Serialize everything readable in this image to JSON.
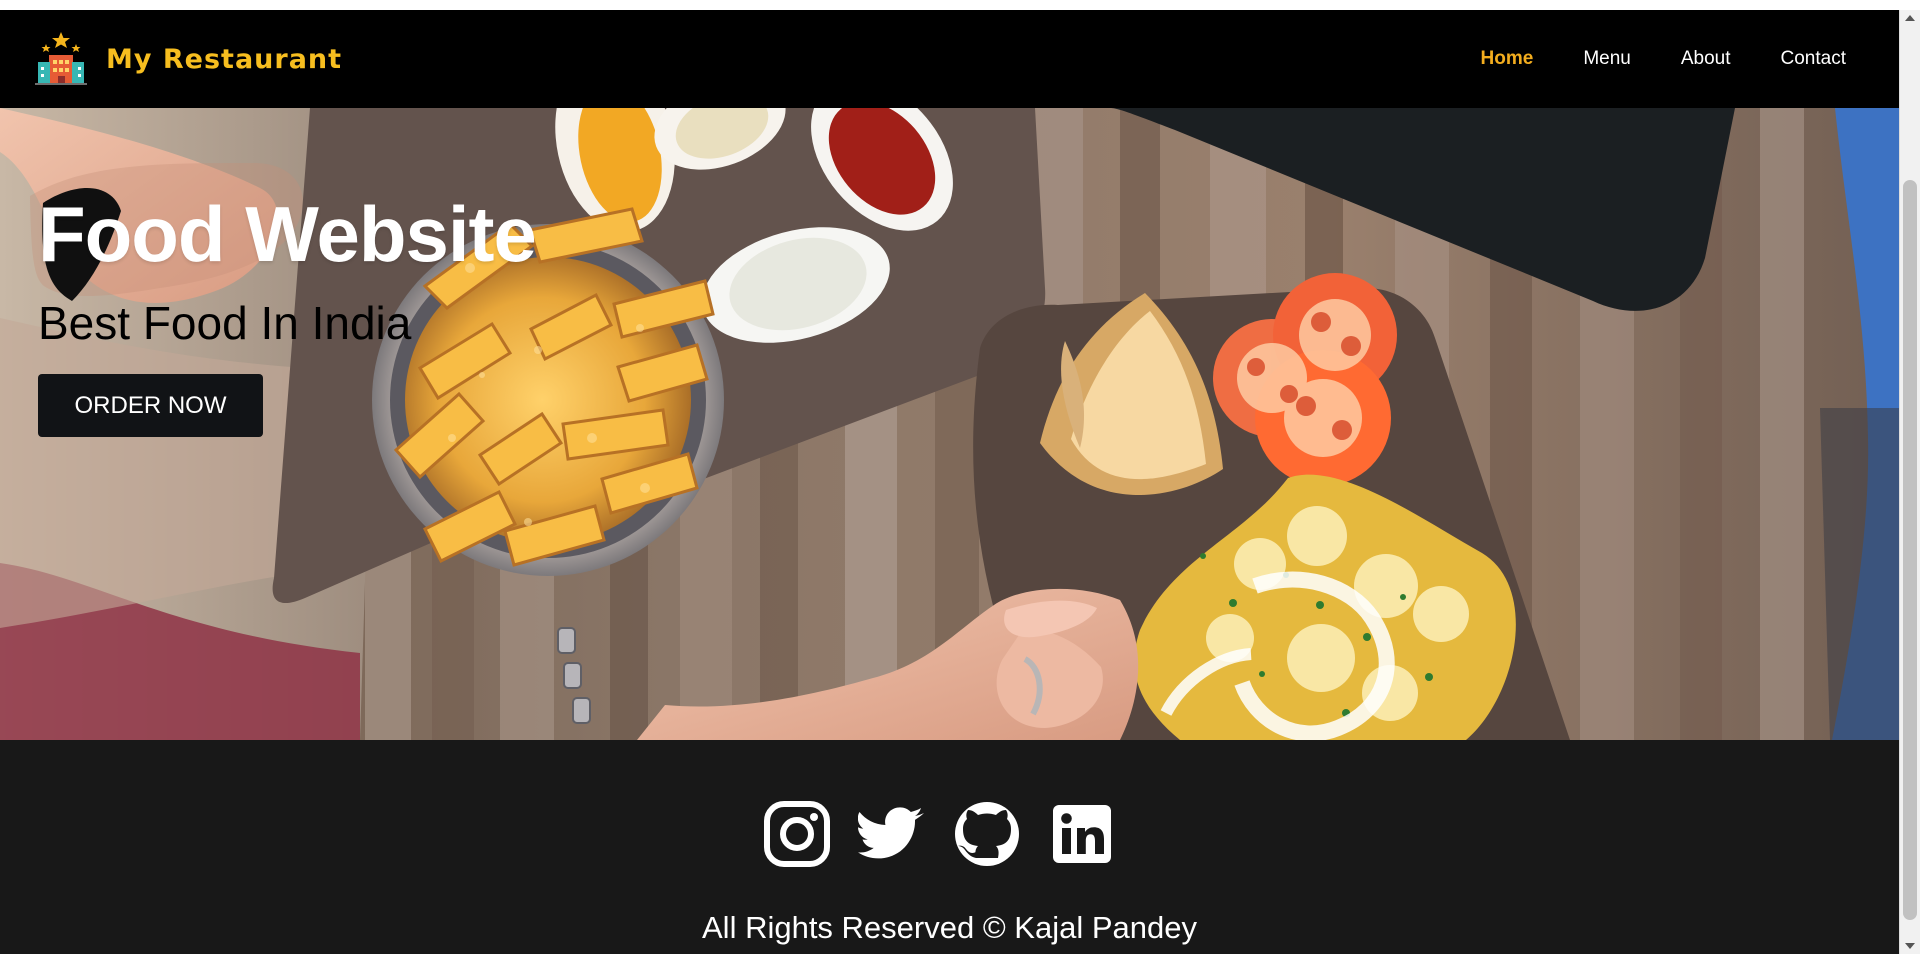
{
  "header": {
    "brand": "My Restaurant",
    "brand_color": "#F7BE1F",
    "nav": [
      {
        "label": "Home",
        "active": true
      },
      {
        "label": "Menu",
        "active": false
      },
      {
        "label": "About",
        "active": false
      },
      {
        "label": "Contact",
        "active": false
      }
    ]
  },
  "hero": {
    "title": "Food Website",
    "subtitle": "Best Food In India",
    "button": "ORDER NOW"
  },
  "footer": {
    "social": [
      {
        "name": "instagram-icon"
      },
      {
        "name": "twitter-icon"
      },
      {
        "name": "github-icon"
      },
      {
        "name": "linkedin-icon"
      }
    ],
    "copyright": "All Rights Reserved © Kajal Pandey"
  },
  "colors": {
    "header_background": "#000000",
    "active_nav": "#F3AD1E",
    "footer_background": "#181818"
  }
}
